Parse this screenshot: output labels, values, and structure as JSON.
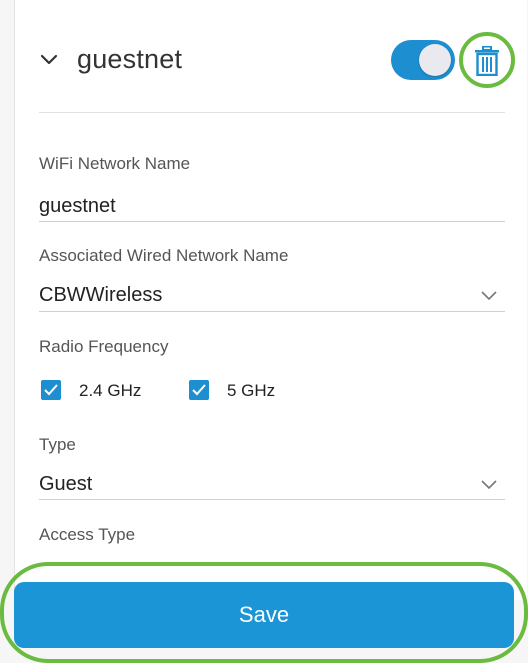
{
  "network": {
    "name": "guestnet",
    "enabled": true
  },
  "icons": {
    "expand": "chevron-down-icon",
    "delete": "trash-icon",
    "select_caret": "chevron-down-icon",
    "check": "check-icon"
  },
  "fields": {
    "wifi_name_label": "WiFi Network Name",
    "wifi_name_value": "guestnet",
    "wired_label": "Associated Wired Network Name",
    "wired_value": "CBWWireless",
    "radio_label": "Radio Frequency",
    "radio_options": [
      "2.4 GHz",
      "5 GHz"
    ],
    "type_label": "Type",
    "type_value": "Guest",
    "access_type_label": "Access Type"
  },
  "actions": {
    "save_label": "Save"
  },
  "colors": {
    "accent": "#1d8ed0",
    "highlight": "#6abb3f"
  }
}
